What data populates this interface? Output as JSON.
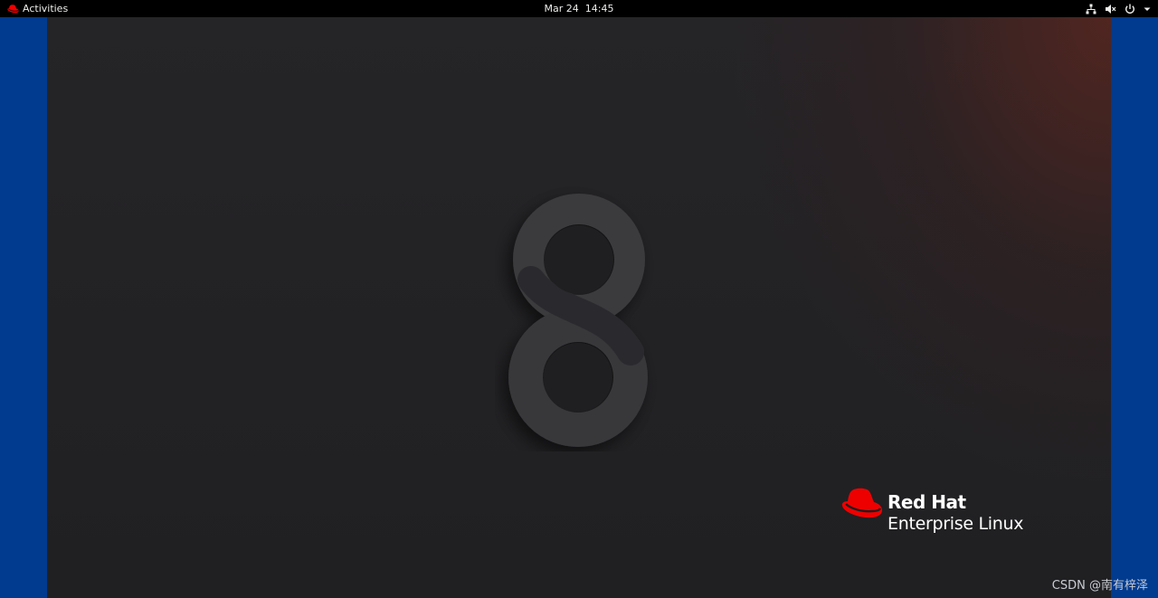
{
  "topbar": {
    "activities_label": "Activities",
    "activities_icon": "redhat-hat-icon",
    "clock": "Mar 24  14:45",
    "tray_icons": [
      "network-wired-icon",
      "volume-muted-icon",
      "power-icon",
      "chevron-down-icon"
    ]
  },
  "desktop": {
    "wallpaper_glyph": "8",
    "brand_line1": "Red Hat",
    "brand_line2": "Enterprise Linux"
  },
  "watermark": "CSDN @南有梓泽",
  "colors": {
    "topbar_bg": "#000000",
    "side_bars": "#003b8f",
    "wallpaper": "#232225",
    "brand_red": "#ee0000"
  }
}
